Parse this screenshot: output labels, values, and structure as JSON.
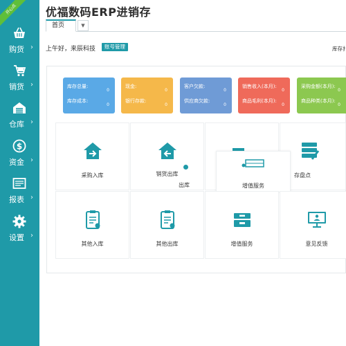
{
  "app": {
    "title": "优福数码ERP进销存",
    "corner_badge": "开心点"
  },
  "tabs": {
    "home_label": "首页",
    "dropdown_icon": "caret-down-icon"
  },
  "greeting": {
    "text": "上午好，来辰科技",
    "account_button": "账号管理",
    "right_partial": "库存扌"
  },
  "sidebar": {
    "items": [
      {
        "label": "购货",
        "icon": "basket-icon"
      },
      {
        "label": "销货",
        "icon": "cart-icon"
      },
      {
        "label": "仓库",
        "icon": "warehouse-icon"
      },
      {
        "label": "资金",
        "icon": "dollar-icon"
      },
      {
        "label": "报表",
        "icon": "report-icon"
      },
      {
        "label": "设置",
        "icon": "gear-icon"
      }
    ],
    "chevron": "›"
  },
  "stats": [
    {
      "line1": "库存总量:",
      "line2": "库存成本:",
      "value1": "0",
      "value2": "0",
      "color": "#5aa9e6"
    },
    {
      "line1": "现金:",
      "line2": "银行存款:",
      "value1": "0",
      "value2": "0",
      "color": "#f5b84a"
    },
    {
      "line1": "客户欠款:",
      "line2": "供应商欠款:",
      "value1": "0",
      "value2": "0",
      "color": "#6f9bd6"
    },
    {
      "line1": "销售收入(本月):",
      "line2": "商品毛利(本月):",
      "value1": "0",
      "value2": "0",
      "color": "#ef6a5a"
    },
    {
      "line1": "采购金额(本月):",
      "line2": "商品种类(本月):",
      "value1": "0",
      "value2": "0",
      "color": "#8cc850"
    }
  ],
  "tiles": {
    "row1": [
      {
        "label": "采购入库",
        "icon": "house-arrow-in-icon"
      },
      {
        "label": "销货出库",
        "icon": "house-arrow-out-icon"
      },
      {
        "label": "",
        "icon": "truck-icon"
      },
      {
        "label": "存盘点",
        "icon": "stack-icon"
      }
    ],
    "overlay_label": "增值服务",
    "overlay_partial": "出库",
    "row2": [
      {
        "label": "其他入库",
        "icon": "clipboard-in-icon"
      },
      {
        "label": "其他出库",
        "icon": "clipboard-out-icon"
      },
      {
        "label": "增值服务",
        "icon": "cabinet-icon"
      },
      {
        "label": "意见反馈",
        "icon": "monitor-icon"
      }
    ]
  },
  "colors": {
    "accent": "#1f9aa8",
    "badge": "#5fbf3a"
  }
}
